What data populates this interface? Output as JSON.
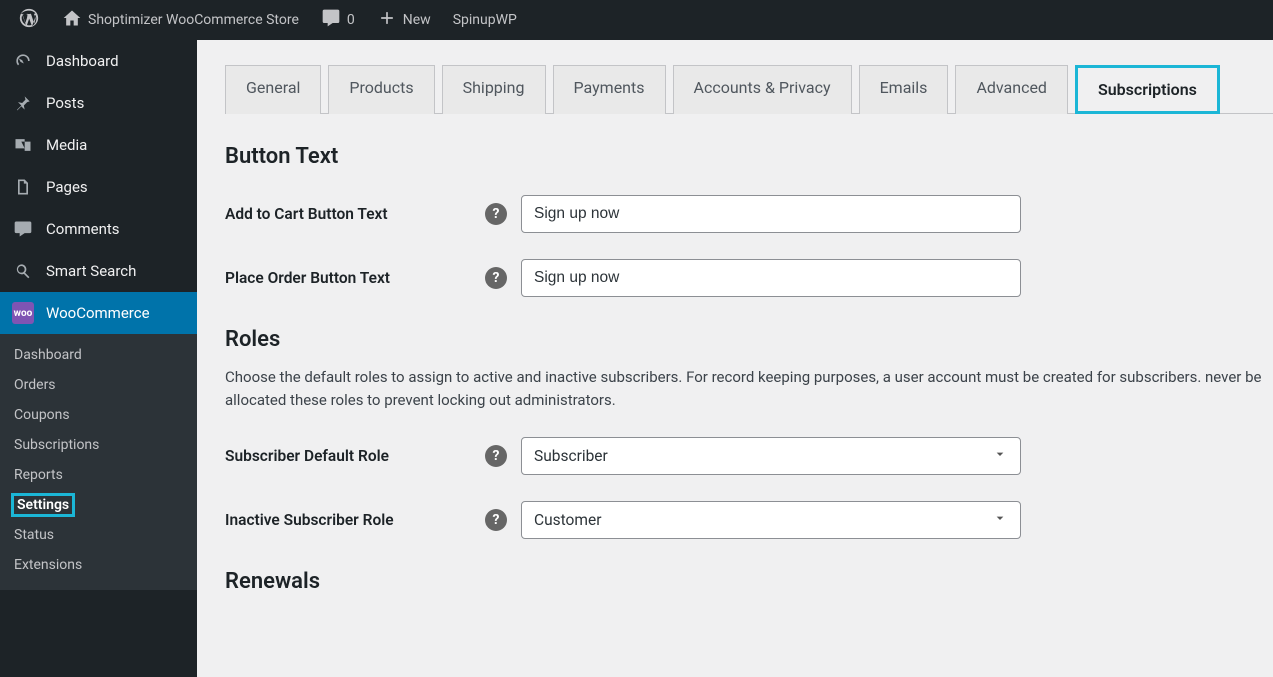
{
  "adminbar": {
    "site_name": "Shoptimizer WooCommerce Store",
    "comments_count": "0",
    "new_label": "New",
    "spinupwp_label": "SpinupWP"
  },
  "sidebar": {
    "items": [
      {
        "label": "Dashboard"
      },
      {
        "label": "Posts"
      },
      {
        "label": "Media"
      },
      {
        "label": "Pages"
      },
      {
        "label": "Comments"
      },
      {
        "label": "Smart Search"
      },
      {
        "label": "WooCommerce"
      }
    ],
    "woocommerce_submenu": [
      {
        "label": "Dashboard"
      },
      {
        "label": "Orders"
      },
      {
        "label": "Coupons"
      },
      {
        "label": "Subscriptions"
      },
      {
        "label": "Reports"
      },
      {
        "label": "Settings",
        "active": true
      },
      {
        "label": "Status"
      },
      {
        "label": "Extensions"
      }
    ]
  },
  "tabs": [
    {
      "label": "General"
    },
    {
      "label": "Products"
    },
    {
      "label": "Shipping"
    },
    {
      "label": "Payments"
    },
    {
      "label": "Accounts & Privacy"
    },
    {
      "label": "Emails"
    },
    {
      "label": "Advanced"
    },
    {
      "label": "Subscriptions",
      "active": true
    }
  ],
  "sections": {
    "button_text": {
      "heading": "Button Text",
      "fields": {
        "add_to_cart": {
          "label": "Add to Cart Button Text",
          "value": "Sign up now"
        },
        "place_order": {
          "label": "Place Order Button Text",
          "value": "Sign up now"
        }
      }
    },
    "roles": {
      "heading": "Roles",
      "description": "Choose the default roles to assign to active and inactive subscribers. For record keeping purposes, a user account must be created for subscribers. never be allocated these roles to prevent locking out administrators.",
      "fields": {
        "default_role": {
          "label": "Subscriber Default Role",
          "value": "Subscriber"
        },
        "inactive_role": {
          "label": "Inactive Subscriber Role",
          "value": "Customer"
        }
      }
    },
    "renewals": {
      "heading": "Renewals"
    }
  }
}
